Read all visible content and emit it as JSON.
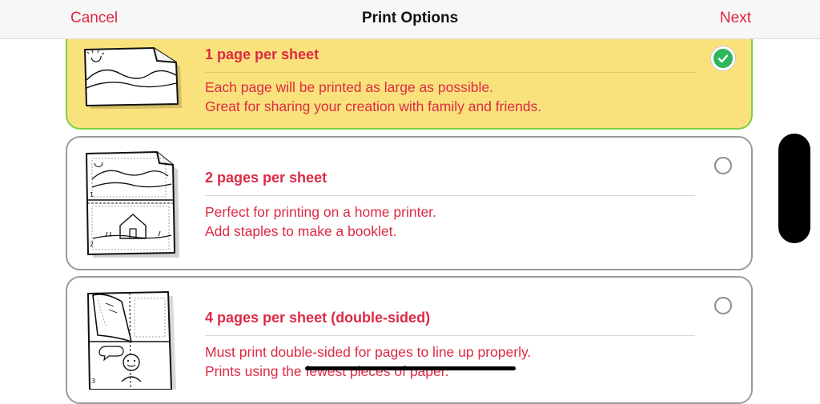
{
  "nav": {
    "cancel_label": "Cancel",
    "title": "Print Options",
    "next_label": "Next"
  },
  "options": [
    {
      "title": "1 page per sheet",
      "desc_line1": "Each page will be printed as large as possible.",
      "desc_line2": "Great for sharing your creation with family and friends.",
      "selected": true
    },
    {
      "title": "2 pages per sheet",
      "desc_line1": "Perfect for printing on a home printer.",
      "desc_line2": "Add staples to make a booklet.",
      "selected": false
    },
    {
      "title": "4 pages per sheet (double-sided)",
      "desc_line1": "Must print double-sided for pages to line up properly.",
      "desc_line2": "Prints using the fewest pieces of paper.",
      "selected": false
    }
  ],
  "thumb_labels": {
    "two_up_page1": "1",
    "two_up_page2": "2",
    "four_up_page3": "3"
  },
  "colors": {
    "accent": "#e0243f",
    "selected_card_bg": "#f9e27c",
    "selected_card_border": "#7ccf45",
    "check_green": "#2fb55a"
  },
  "icons": {
    "selected_indicator": "checkmark-circle-icon",
    "unselected_indicator": "radio-empty-icon"
  }
}
